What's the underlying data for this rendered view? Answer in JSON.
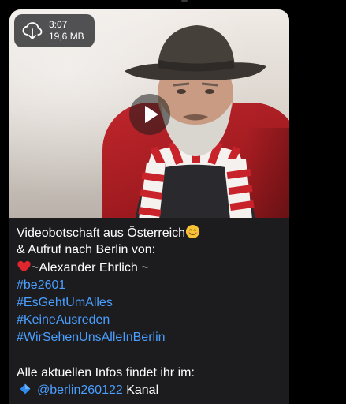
{
  "message": {
    "video": {
      "duration": "3:07",
      "file_size": "19,6 MB",
      "download_icon": "cloud-download-icon",
      "play_icon": "play-icon"
    },
    "caption": {
      "line1": "Videobotschaft aus Österreich",
      "line2": "& Aufruf nach Berlin von:",
      "line3": "~Alexander Ehrlich ~",
      "hashtags": [
        "#be2601",
        "#EsGehtUmAlles",
        "#KeineAusreden",
        "#WirSehenUnsAlleInBerlin"
      ],
      "info_line": "Alle aktuellen Infos findet ihr im:",
      "channel_mention": "@berlin260122",
      "channel_suffix": " Kanal"
    },
    "emojis": [
      "smiling-face-emoji",
      "red-heart-emoji",
      "blue-diamond-emoji"
    ]
  },
  "colors": {
    "background": "#000000",
    "bubble": "#1c1c1e",
    "text": "#ffffff",
    "link": "#4a9eff"
  }
}
